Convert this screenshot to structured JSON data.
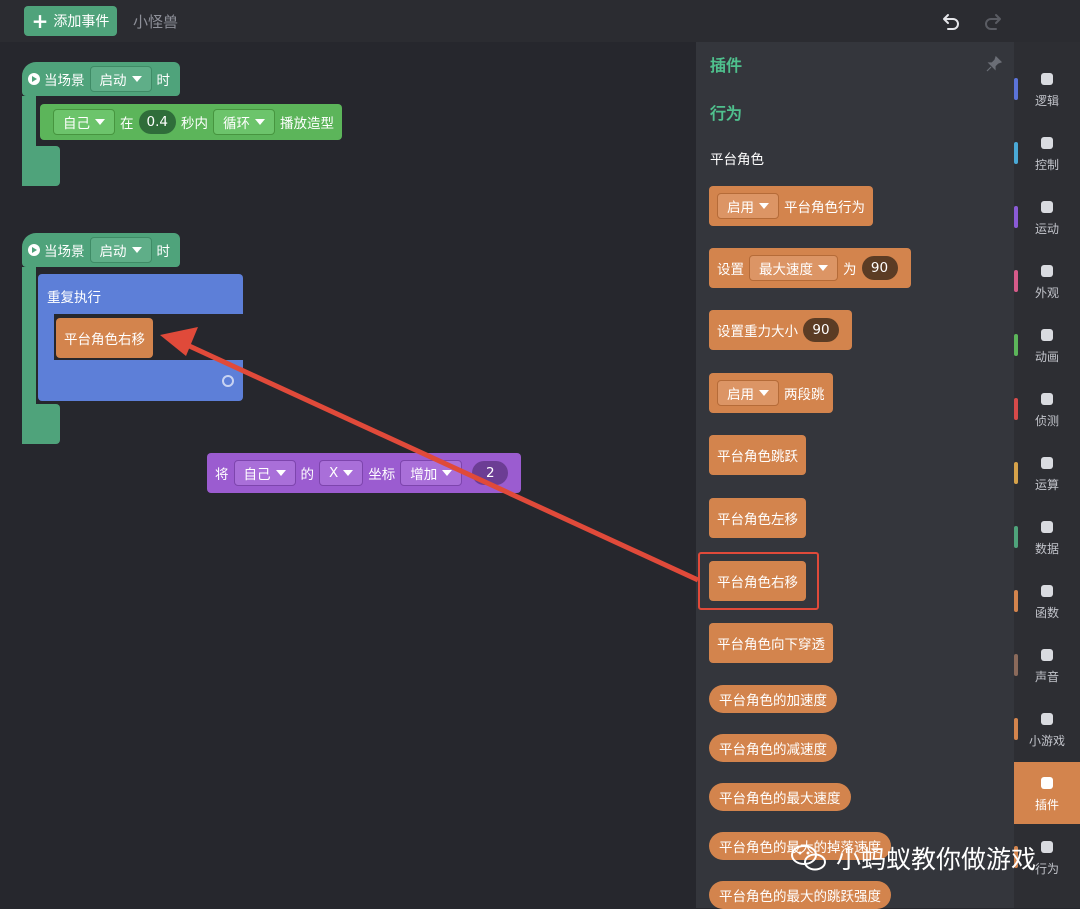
{
  "topbar": {
    "add_event_label": "添加事件",
    "sprite_name": "小怪兽",
    "undo_icon": "undo-icon",
    "redo_icon": "redo-icon"
  },
  "workspace": {
    "script1": {
      "hat_prefix": "当场景",
      "hat_dropdown": "启动",
      "hat_suffix": "时",
      "block": {
        "target": "自己",
        "in_label": "在",
        "duration": "0.4",
        "within_label": "秒内",
        "mode": "循环",
        "action_label": "播放造型"
      }
    },
    "script2": {
      "hat_prefix": "当场景",
      "hat_dropdown": "启动",
      "hat_suffix": "时",
      "repeat_label": "重复执行",
      "inner_block": "平台角色右移"
    },
    "loose_block": {
      "prefix": "将",
      "target": "自己",
      "of_label": "的",
      "axis": "X",
      "coord_label": "坐标",
      "op": "增加",
      "value": "2"
    }
  },
  "panel": {
    "title": "插件",
    "section": "行为",
    "group": "平台角色",
    "blocks": {
      "enable_dd": "启用",
      "enable_text": "平台角色行为",
      "set_label": "设置",
      "set_dd": "最大速度",
      "set_as": "为",
      "set_value": "90",
      "gravity_label": "设置重力大小",
      "gravity_value": "90",
      "double_dd": "启用",
      "double_text": "两段跳",
      "jump": "平台角色跳跃",
      "left": "平台角色左移",
      "right": "平台角色右移",
      "drop": "平台角色向下穿透",
      "accel": "平台角色的加速度",
      "decel": "平台角色的减速度",
      "maxspeed": "平台角色的最大速度",
      "fall": "平台角色的最大的掉落速度",
      "jumpstr": "平台角色的最大的跳跃强度"
    }
  },
  "categories": [
    {
      "label": "逻辑",
      "icon": "logic-icon",
      "color": "#5b73d8"
    },
    {
      "label": "控制",
      "icon": "control-icon",
      "color": "#4aa9d6"
    },
    {
      "label": "运动",
      "icon": "motion-icon",
      "color": "#8a5bd6"
    },
    {
      "label": "外观",
      "icon": "looks-icon",
      "color": "#d65b8a"
    },
    {
      "label": "动画",
      "icon": "animation-icon",
      "color": "#5cb55a"
    },
    {
      "label": "侦测",
      "icon": "sensing-icon",
      "color": "#d64a4a"
    },
    {
      "label": "运算",
      "icon": "operator-icon",
      "color": "#d6a24a"
    },
    {
      "label": "数据",
      "icon": "data-icon",
      "color": "#4fa37b"
    },
    {
      "label": "函数",
      "icon": "function-icon",
      "color": "#d3844d"
    },
    {
      "label": "声音",
      "icon": "sound-icon",
      "color": "#8a6a5b"
    },
    {
      "label": "小游戏",
      "icon": "minigame-icon",
      "color": "#d3844d"
    },
    {
      "label": "插件",
      "icon": "plugin-icon",
      "color": "#d3844d"
    },
    {
      "label": "行为",
      "icon": "behavior-icon",
      "color": "#d3844d"
    }
  ],
  "watermark": "小蚂蚁教你做游戏",
  "colors": {
    "accent_green": "#4fa37b",
    "plugin_orange": "#d3844d",
    "arrow_red": "#e04a3a"
  }
}
